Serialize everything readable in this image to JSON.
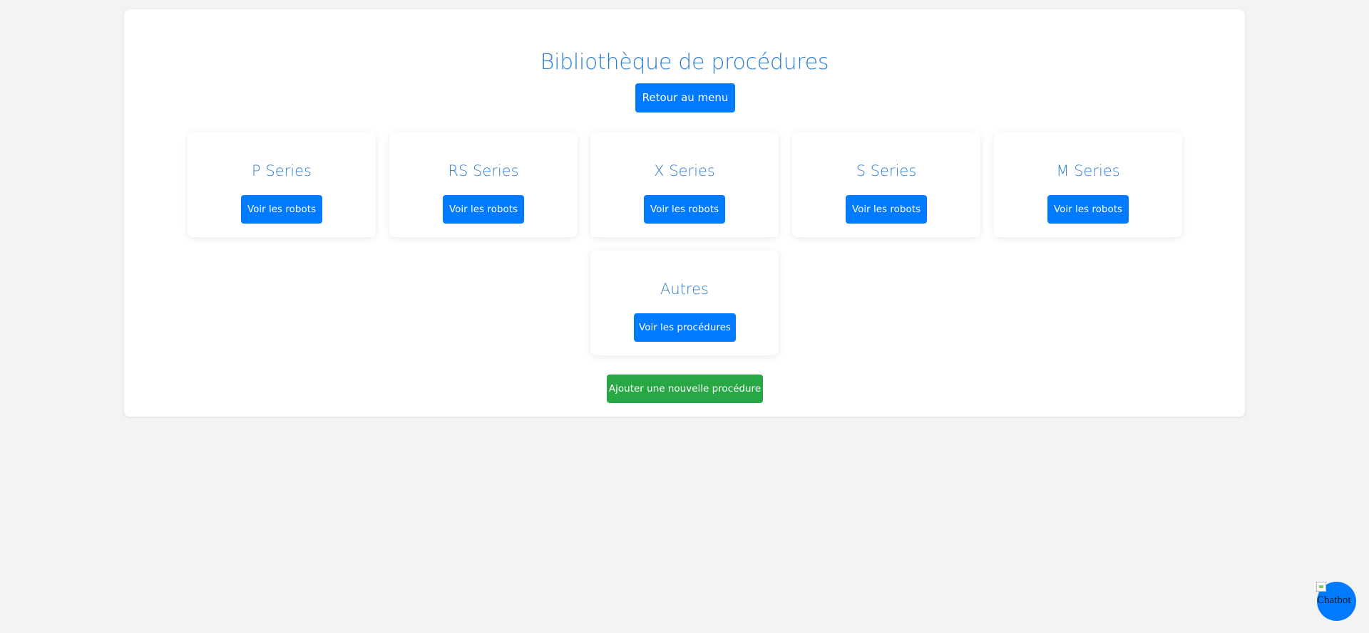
{
  "page": {
    "title": "Bibliothèque de procédures",
    "back_button_label": "Retour au menu",
    "add_button_label": "Ajouter une nouvelle procédure"
  },
  "cards": [
    {
      "title": "P Series",
      "button_label": "Voir les robots"
    },
    {
      "title": "RS Series",
      "button_label": "Voir les robots"
    },
    {
      "title": "X Series",
      "button_label": "Voir les robots"
    },
    {
      "title": "S Series",
      "button_label": "Voir les robots"
    },
    {
      "title": "M Series",
      "button_label": "Voir les robots"
    },
    {
      "title": "Autres",
      "button_label": "Voir les procédures"
    }
  ],
  "chatbot": {
    "alt_text": "Chatbot",
    "icon": "chatbot-icon"
  },
  "colors": {
    "background": "#f3f3f3",
    "panel": "#ffffff",
    "title": "#2f80d1",
    "primary": "#007bff",
    "success": "#28a745"
  }
}
